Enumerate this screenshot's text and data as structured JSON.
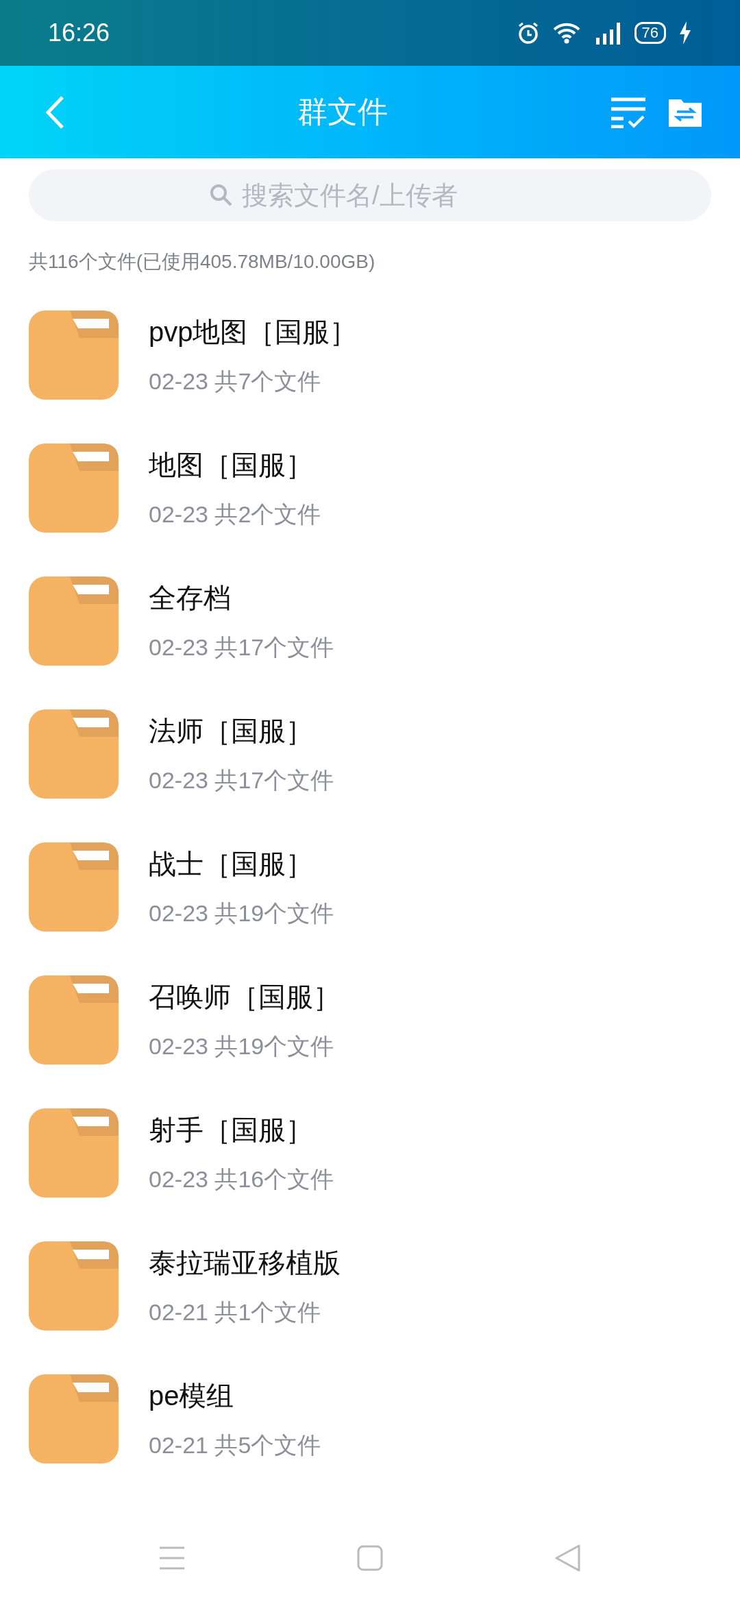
{
  "status_bar": {
    "time": "16:26",
    "battery": "76"
  },
  "header": {
    "title": "群文件"
  },
  "search": {
    "placeholder": "搜索文件名/上传者"
  },
  "summary": "共116个文件(已使用405.78MB/10.00GB)",
  "folders": [
    {
      "name": "pvp地图［国服］",
      "date": "02-23",
      "count": "共7个文件"
    },
    {
      "name": "地图［国服］",
      "date": "02-23",
      "count": "共2个文件"
    },
    {
      "name": "全存档",
      "date": "02-23",
      "count": "共17个文件"
    },
    {
      "name": "法师［国服］",
      "date": "02-23",
      "count": "共17个文件"
    },
    {
      "name": "战士［国服］",
      "date": "02-23",
      "count": "共19个文件"
    },
    {
      "name": "召唤师［国服］",
      "date": "02-23",
      "count": "共19个文件"
    },
    {
      "name": "射手［国服］",
      "date": "02-23",
      "count": "共16个文件"
    },
    {
      "name": "泰拉瑞亚移植版",
      "date": "02-21",
      "count": "共1个文件"
    },
    {
      "name": "pe模组",
      "date": "02-21",
      "count": "共5个文件"
    }
  ]
}
